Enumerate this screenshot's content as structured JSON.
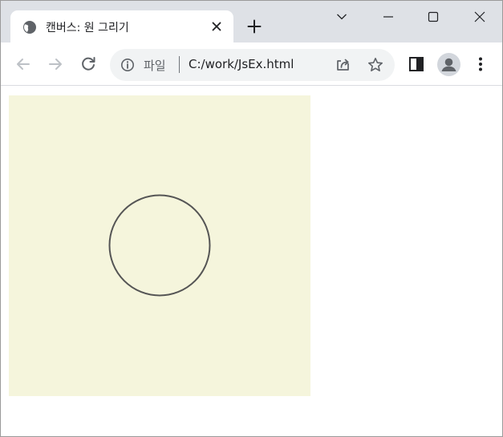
{
  "window": {
    "tab": {
      "title": "캔버스: 원 그리기",
      "favicon": "globe-icon",
      "close_icon": "close-icon"
    },
    "new_tab_icon": "plus-icon",
    "controls": [
      "tab-search-chevron-icon",
      "minimize-icon",
      "maximize-icon",
      "close-window-icon"
    ]
  },
  "toolbar": {
    "back_icon": "back-arrow-icon",
    "forward_icon": "forward-arrow-icon",
    "reload_icon": "reload-icon",
    "omnibox": {
      "info_icon": "info-icon",
      "scheme_label": "파일",
      "url": "C:/work/JsEx.html",
      "share_icon": "share-icon",
      "bookmark_icon": "star-icon"
    },
    "side_panel_icon": "side-panel-icon",
    "profile_icon": "avatar",
    "menu_icon": "kebab-menu-icon"
  },
  "page": {
    "canvas": {
      "background_color": "#f5f5dc",
      "stroke_color": "#555555",
      "shape": "circle"
    }
  },
  "colors": {
    "tabstrip": "#dee1e6",
    "omnibox": "#f1f3f4",
    "icon": "#5f6368",
    "icon_disabled": "#bdc1c6"
  }
}
